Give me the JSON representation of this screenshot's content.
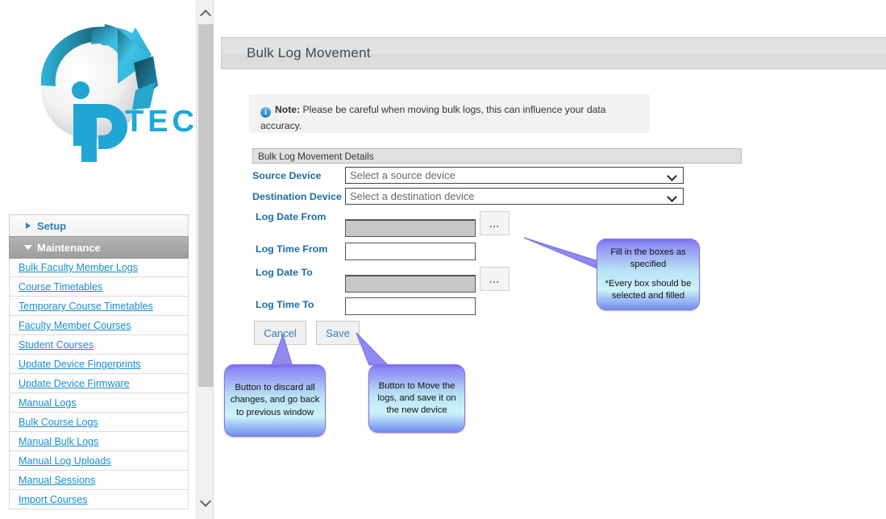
{
  "brand": {
    "name": "iP TECH",
    "primary_color": "#2bb3d6",
    "dark_color": "#12414f"
  },
  "scrollbar": {
    "up_icon": "chevron-up-icon",
    "down_icon": "chevron-down-icon"
  },
  "sidebar": {
    "groups": [
      {
        "label": "Setup",
        "expanded": false,
        "icon": "chevron-right-icon",
        "items": []
      },
      {
        "label": "Maintenance",
        "expanded": true,
        "icon": "chevron-down-icon",
        "items": [
          "Bulk Faculty Member Logs",
          "Course Timetables",
          "Temporary Course Timetables",
          "Faculty Member Courses",
          "Student Courses",
          "Update Device Fingerprints",
          "Update Device Firmware",
          "Manual Logs",
          "Bulk Course Logs",
          "Manual Bulk Logs",
          "Manual Log Uploads",
          "Manual Sessions",
          "Import Courses"
        ]
      }
    ]
  },
  "page": {
    "title": "Bulk Log Movement",
    "note": {
      "icon": "info-icon",
      "strong": "Note:",
      "text": " Please be careful when moving bulk logs, this can influence your data accuracy."
    },
    "section_header": "Bulk Log Movement Details"
  },
  "form": {
    "source_device": {
      "label": "Source Device",
      "value": "Select a source device",
      "caret": "chevron-down-icon"
    },
    "destination_device": {
      "label": "Destination Device",
      "value": "Select a destination device",
      "caret": "chevron-down-icon"
    },
    "log_date_from": {
      "label": "Log Date From",
      "value": "",
      "browse": "..."
    },
    "log_time_from": {
      "label": "Log Time From",
      "value": ""
    },
    "log_date_to": {
      "label": "Log Date To",
      "value": "",
      "browse": "..."
    },
    "log_time_to": {
      "label": "Log Time To",
      "value": ""
    },
    "cancel_label": "Cancel",
    "save_label": "Save"
  },
  "callouts": {
    "fields": {
      "line1": "Fill in the boxes as specified",
      "line2": "*Every box should be selected and filled"
    },
    "cancel": {
      "line1": "Button to discard all changes, and go back to previous window"
    },
    "save": {
      "line1": "Button to Move the logs, and save it on the new device"
    }
  }
}
